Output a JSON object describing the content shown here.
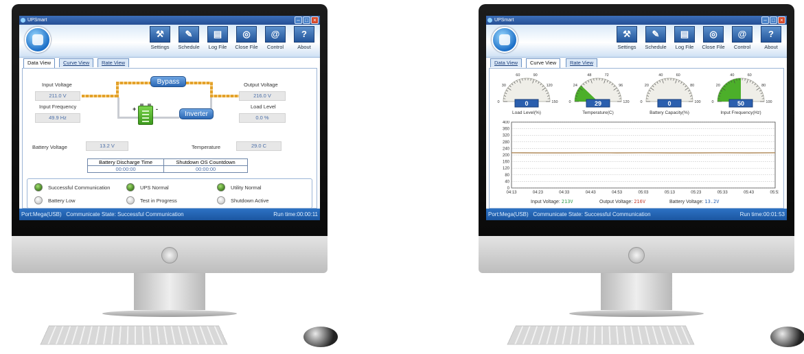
{
  "colors": {
    "accent": "#2b68b5",
    "flow": "#e3a12a",
    "led_on": "#5aa82c",
    "gauge_fill": "#4caf2a",
    "input_voltage": "#2e9a4a",
    "output_voltage": "#c0392b",
    "battery_voltage": "#2860b0",
    "plot_line": "#b08a5a"
  },
  "left": {
    "app_title": "UPSmart",
    "toolbar": [
      {
        "label": "Settings",
        "icon": "hammer-icon",
        "glyph": "⚒"
      },
      {
        "label": "Schedule",
        "icon": "pencil-icon",
        "glyph": "✎"
      },
      {
        "label": "Log File",
        "icon": "document-icon",
        "glyph": "▤"
      },
      {
        "label": "Close File",
        "icon": "close-file-icon",
        "glyph": "◎"
      },
      {
        "label": "Control",
        "icon": "at-sign-icon",
        "glyph": "@"
      },
      {
        "label": "About",
        "icon": "question-icon",
        "glyph": "?"
      }
    ],
    "tabs": [
      "Data View",
      "Curve View",
      "Rate View"
    ],
    "active_tab": 0,
    "data_view": {
      "input_voltage_label": "Input Voltage",
      "input_voltage": "211.0 V",
      "input_frequency_label": "Input Frequency",
      "input_frequency": "49.9 Hz",
      "output_voltage_label": "Output Voltage",
      "output_voltage": "216.0 V",
      "load_level_label": "Load Level",
      "load_level": "0.0 %",
      "bypass_label": "Bypass",
      "inverter_label": "Inverter",
      "plus": "+",
      "minus": "-",
      "battery_voltage_label": "Battery Voltage",
      "battery_voltage": "13.2 V",
      "temperature_label": "Temperature",
      "temperature": "29.0 C",
      "discharge_time_label": "Battery Discharge Time",
      "discharge_time": "00:00:00",
      "shutdown_countdown_label": "Shutdown OS Countdown",
      "shutdown_countdown": "00:00:00",
      "indicators": [
        {
          "label": "Successful Communication",
          "on": true
        },
        {
          "label": "UPS Normal",
          "on": true
        },
        {
          "label": "Utility Normal",
          "on": true
        },
        {
          "label": "Battery Low",
          "on": false
        },
        {
          "label": "Test in Progress",
          "on": false
        },
        {
          "label": "Shutdown Active",
          "on": false
        }
      ]
    },
    "status": {
      "port": "Port:Mega(USB)",
      "communicate": "Communicate State: Successful Communication",
      "runtime": "Run time:00:00:11"
    }
  },
  "right": {
    "app_title": "UPSmart",
    "toolbar": [
      {
        "label": "Settings",
        "icon": "hammer-icon",
        "glyph": "⚒"
      },
      {
        "label": "Schedule",
        "icon": "pencil-icon",
        "glyph": "✎"
      },
      {
        "label": "Log File",
        "icon": "document-icon",
        "glyph": "▤"
      },
      {
        "label": "Close File",
        "icon": "close-file-icon",
        "glyph": "◎"
      },
      {
        "label": "Control",
        "icon": "at-sign-icon",
        "glyph": "@"
      },
      {
        "label": "About",
        "icon": "question-icon",
        "glyph": "?"
      }
    ],
    "tabs": [
      "Data View",
      "Curve View",
      "Rate View"
    ],
    "active_tab": 1,
    "gauges": [
      {
        "label": "Load Level(%)",
        "value": 0,
        "display": "0",
        "min": 0,
        "max": 150,
        "ticks": [
          "0",
          "30",
          "60",
          "90",
          "120",
          "150"
        ]
      },
      {
        "label": "Temperature(C)",
        "value": 29,
        "display": "29",
        "min": 0,
        "max": 120,
        "ticks": [
          "0",
          "24",
          "48",
          "72",
          "96",
          "120"
        ]
      },
      {
        "label": "Battery Capacity(%)",
        "value": 0,
        "display": "0",
        "min": 0,
        "max": 100,
        "ticks": [
          "0",
          "20",
          "40",
          "60",
          "80",
          "100"
        ]
      },
      {
        "label": "Input Frequency(Hz)",
        "value": 50,
        "display": "50",
        "min": 0,
        "max": 100,
        "ticks": [
          "0",
          "20",
          "40",
          "60",
          "80",
          "100"
        ]
      }
    ],
    "chart_data": {
      "type": "line",
      "title": "",
      "xlabel": "",
      "ylabel": "",
      "ylim": [
        0,
        400
      ],
      "yticks": [
        "0",
        "40",
        "80",
        "120",
        "160",
        "200",
        "240",
        "280",
        "320",
        "360",
        "400"
      ],
      "x": [
        "04:13",
        "04:23",
        "04:33",
        "04:43",
        "04:53",
        "05:03",
        "05:13",
        "05:23",
        "05:33",
        "05:43",
        "05:53"
      ],
      "grid": true,
      "series": [
        {
          "values": [
            214,
            213,
            213,
            214,
            213,
            214,
            213,
            213,
            214,
            213,
            214
          ]
        }
      ]
    },
    "readouts": [
      {
        "label": "Input Voltage:",
        "value": "213V"
      },
      {
        "label": "Output Voltage:",
        "value": "216V"
      },
      {
        "label": "Battery Voltage:",
        "value": "13.2V"
      }
    ],
    "status": {
      "port": "Port:Mega(USB)",
      "communicate": "Communicate State: Successful Communication",
      "runtime": "Run time:00:01:53"
    }
  }
}
